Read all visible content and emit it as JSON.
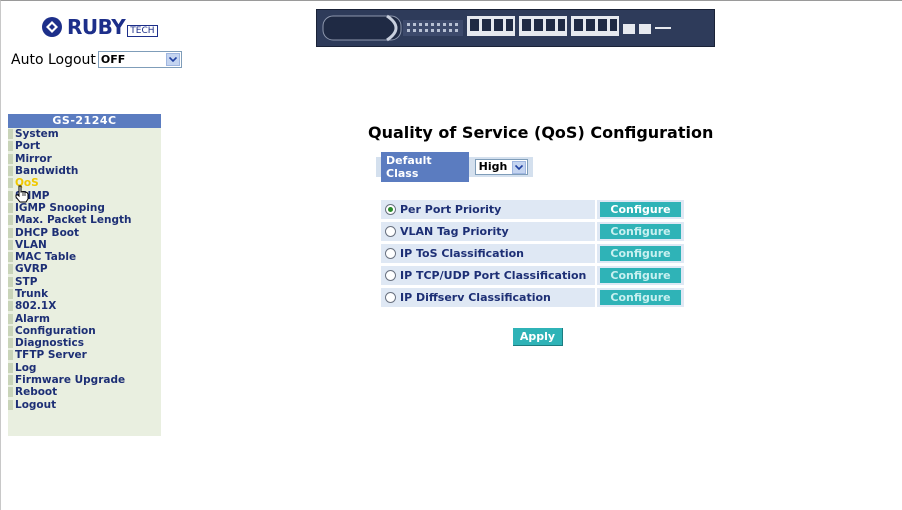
{
  "header": {
    "brand": "RUBY",
    "brand_suffix": "TECH",
    "auto_logout_label": "Auto Logout",
    "auto_logout_value": "OFF"
  },
  "sidebar": {
    "model": "GS-2124C",
    "items": [
      {
        "label": "System"
      },
      {
        "label": "Port"
      },
      {
        "label": "Mirror"
      },
      {
        "label": "Bandwidth"
      },
      {
        "label": "QoS",
        "active": true
      },
      {
        "label": "SNMP"
      },
      {
        "label": "IGMP Snooping"
      },
      {
        "label": "Max. Packet Length"
      },
      {
        "label": "DHCP Boot"
      },
      {
        "label": "VLAN"
      },
      {
        "label": "MAC Table"
      },
      {
        "label": "GVRP"
      },
      {
        "label": "STP"
      },
      {
        "label": "Trunk"
      },
      {
        "label": "802.1X"
      },
      {
        "label": "Alarm"
      },
      {
        "label": "Configuration"
      },
      {
        "label": "Diagnostics"
      },
      {
        "label": "TFTP Server"
      },
      {
        "label": "Log"
      },
      {
        "label": "Firmware Upgrade"
      },
      {
        "label": "Reboot"
      },
      {
        "label": "Logout"
      }
    ]
  },
  "main": {
    "title": "Quality of Service (QoS) Configuration",
    "default_class_label": "Default Class",
    "default_class_value": "High",
    "priority_options": [
      {
        "label": "Per Port Priority",
        "selected": true,
        "button": "Configure"
      },
      {
        "label": "VLAN Tag Priority",
        "selected": false,
        "button": "Configure"
      },
      {
        "label": "IP ToS Classification",
        "selected": false,
        "button": "Configure"
      },
      {
        "label": "IP TCP/UDP Port Classification",
        "selected": false,
        "button": "Configure"
      },
      {
        "label": "IP Diffserv Classification",
        "selected": false,
        "button": "Configure"
      }
    ],
    "apply_label": "Apply"
  },
  "colors": {
    "accent": "#2fb3b7",
    "sidebar_header": "#5b7cc0",
    "link": "#1d2f75",
    "active_link": "#f0c800"
  }
}
